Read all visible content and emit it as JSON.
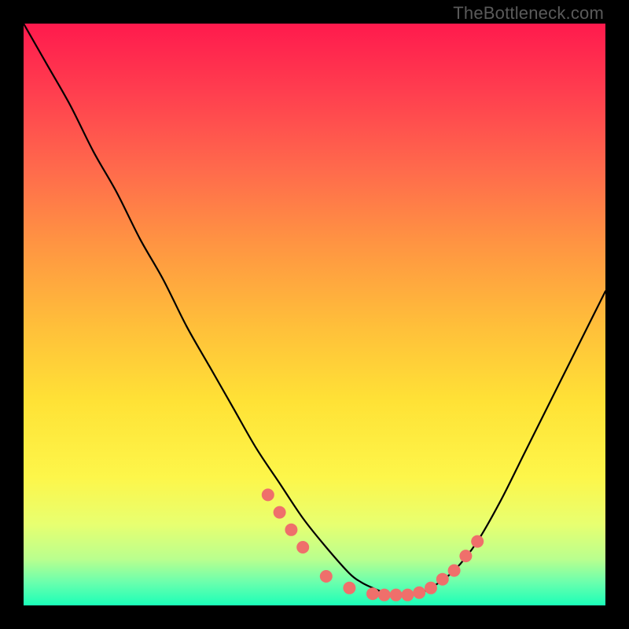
{
  "watermark": "TheBottleneck.com",
  "colors": {
    "background": "#000000",
    "gradient_top": "#ff1a4d",
    "gradient_bottom": "#1bffb8",
    "curve": "#000000",
    "marker": "#ef6f6b"
  },
  "chart_data": {
    "type": "line",
    "title": "",
    "xlabel": "",
    "ylabel": "",
    "xlim": [
      0,
      100
    ],
    "ylim": [
      0,
      100
    ],
    "series": [
      {
        "name": "bottleneck-curve",
        "x": [
          0,
          4,
          8,
          12,
          16,
          20,
          24,
          28,
          32,
          36,
          40,
          44,
          48,
          52,
          56,
          58,
          60,
          62,
          64,
          66,
          68,
          70,
          74,
          78,
          82,
          86,
          90,
          94,
          98,
          100
        ],
        "y": [
          100,
          93,
          86,
          78,
          71,
          63,
          56,
          48,
          41,
          34,
          27,
          21,
          15,
          10,
          5.5,
          4,
          3,
          2.2,
          1.8,
          1.8,
          2.2,
          3,
          6,
          11,
          18,
          26,
          34,
          42,
          50,
          54
        ]
      }
    ],
    "markers": {
      "name": "bottleneck-zone-markers",
      "x": [
        42,
        44,
        46,
        48,
        52,
        56,
        60,
        62,
        64,
        66,
        68,
        70,
        72,
        74,
        76,
        78
      ],
      "y": [
        19,
        16,
        13,
        10,
        5,
        3,
        2,
        1.8,
        1.8,
        1.8,
        2.2,
        3,
        4.5,
        6,
        8.5,
        11
      ]
    }
  }
}
